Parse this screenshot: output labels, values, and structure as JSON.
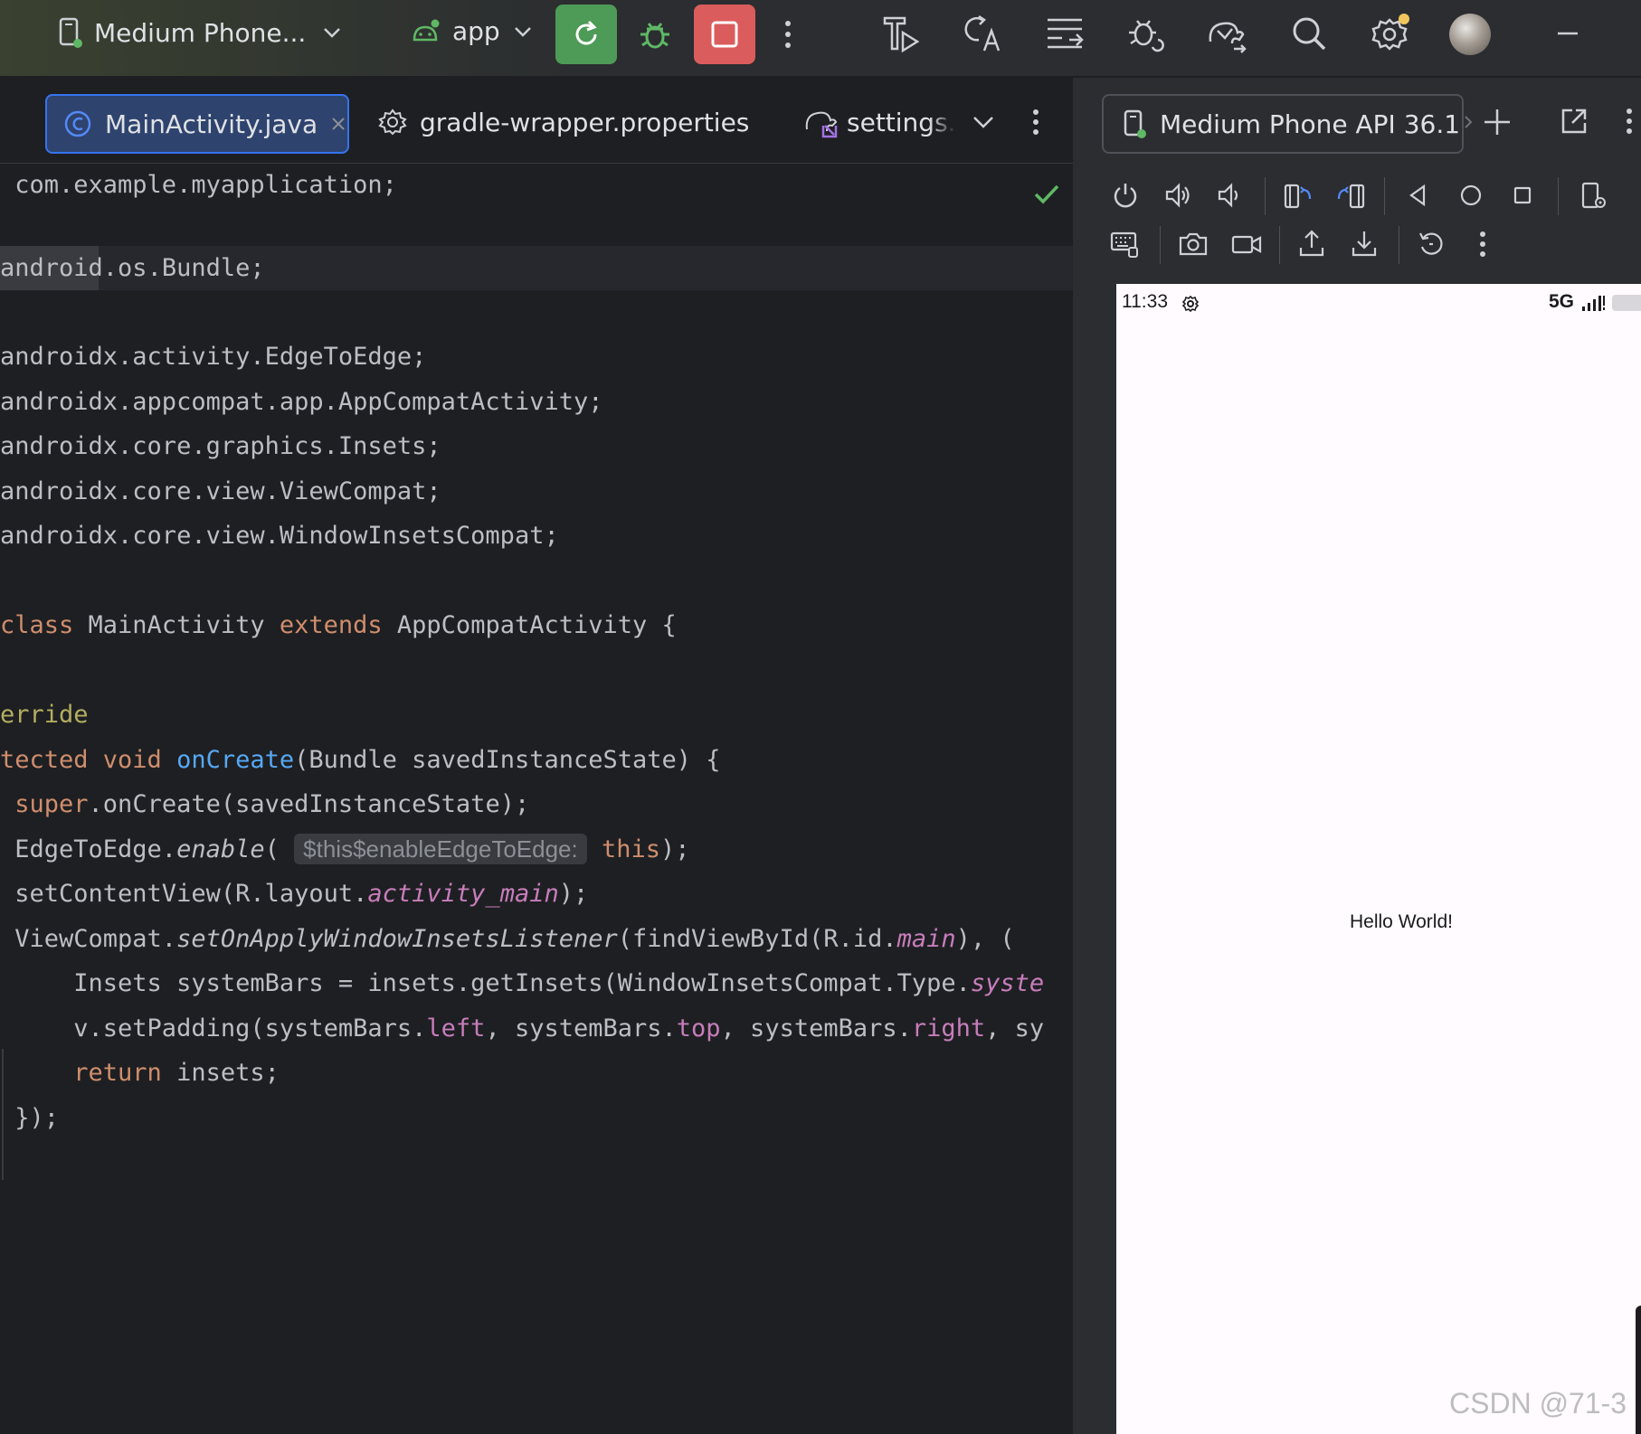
{
  "toolbar": {
    "device_selector": "Medium Phone...",
    "run_config": "app",
    "accent_run": "#4e9a57",
    "accent_stop": "#db5c5c",
    "icons": [
      "device-icon",
      "android-icon",
      "chevron-down-icon",
      "rerun-icon",
      "debug-icon",
      "stop-icon",
      "more-vert-icon",
      "profile-run-icon",
      "translate-icon",
      "layout-icon",
      "bug-sync-icon",
      "elephant-sync-icon",
      "search-icon",
      "settings-icon",
      "avatar",
      "minimize-icon"
    ]
  },
  "editor": {
    "tabs": [
      {
        "label": "MainActivity.java",
        "icon": "class-c-icon",
        "active": true
      },
      {
        "label": "gradle-wrapper.properties",
        "icon": "gear-icon",
        "active": false
      },
      {
        "label": "settings.",
        "icon": "gradle-elephant-icon",
        "active": false
      }
    ],
    "code": {
      "l1": " com.example.myapplication;",
      "l2a": "android",
      "l2b": ".os.Bundle;",
      "l3": "androidx.activity.EdgeToEdge;",
      "l4": "androidx.appcompat.app.AppCompatActivity;",
      "l5": "androidx.core.graphics.Insets;",
      "l6": "androidx.core.view.ViewCompat;",
      "l7": "androidx.core.view.WindowInsetsCompat;",
      "l8a": "class",
      "l8b": " MainActivity ",
      "l8c": "extends",
      "l8d": " AppCompatActivity {",
      "l9": "erride",
      "l10a": "tected void ",
      "l10b": "onCreate",
      "l10c": "(Bundle savedInstanceState) {",
      "l11a": " ",
      "l11b": "super",
      "l11c": ".onCreate(savedInstanceState);",
      "l12a": " EdgeToEdge.",
      "l12b": "enable",
      "l12c": "(",
      "l12hint": "$this$enableEdgeToEdge:",
      "l12d": "this",
      "l12e": ");",
      "l13a": " setContentView(R.layout.",
      "l13b": "activity_main",
      "l13c": ");",
      "l14a": " ViewCompat.",
      "l14b": "setOnApplyWindowInsetsListener",
      "l14c": "(findViewById(R.id.",
      "l14d": "main",
      "l14e": "), (",
      "l15a": "     Insets systemBars = insets.getInsets(WindowInsetsCompat.Type.",
      "l15b": "syste",
      "l16a": "     v.setPadding(systemBars.",
      "l16b": "left",
      "l16c": ", systemBars.",
      "l16d": "top",
      "l16e": ", systemBars.",
      "l16f": "right",
      "l16g": ", sy",
      "l17a": "     ",
      "l17b": "return",
      "l17c": " insets;",
      "l18": " });"
    }
  },
  "emulator": {
    "device_tab": "Medium Phone API 36.1",
    "status_time": "11:33",
    "network": "5G",
    "hello_text": "Hello World!",
    "controls": [
      "power-icon",
      "volume-up-icon",
      "volume-down-icon",
      "rotate-left-icon",
      "rotate-right-icon",
      "back-icon",
      "home-icon",
      "overview-icon",
      "device-settings-icon",
      "keyboard-icon",
      "camera-icon",
      "record-icon",
      "upload-icon",
      "download-icon",
      "undo-icon",
      "more-vert-icon"
    ]
  },
  "watermark": "CSDN @71-3"
}
